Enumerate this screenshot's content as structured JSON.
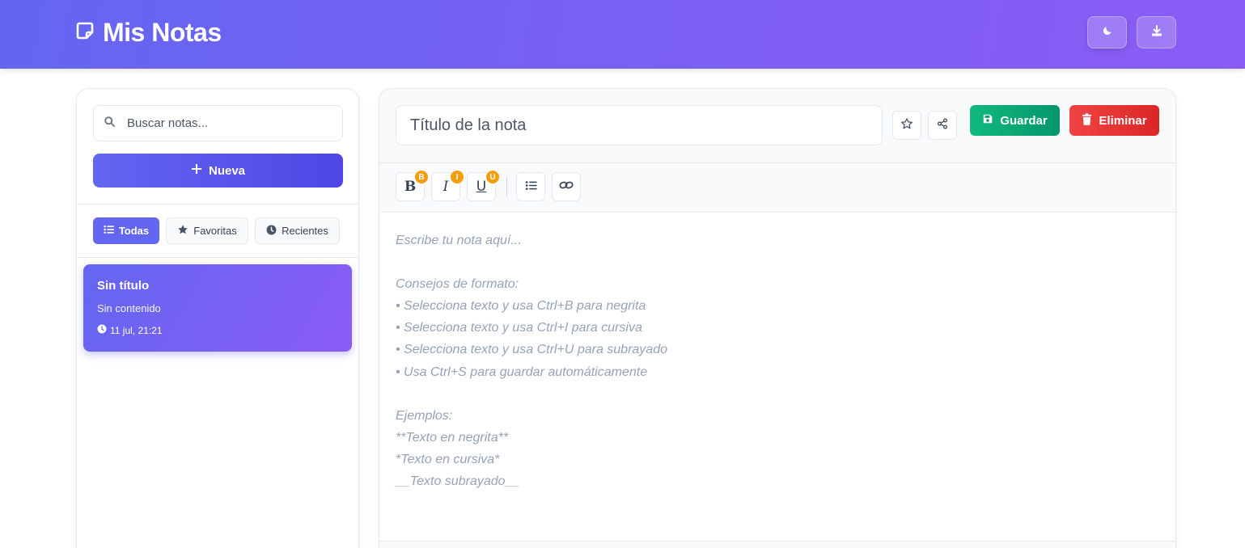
{
  "app": {
    "title": "Mis Notas",
    "logo_icon": "sticky-note-icon",
    "theme_toggle_icon": "moon-icon",
    "export_icon": "download-icon"
  },
  "colors": {
    "primary": "#6366f1",
    "secondary": "#8b5cf6",
    "save": "#10b981",
    "delete": "#ef4444",
    "badge": "#f59e0b"
  },
  "sidebar": {
    "search_placeholder": "Buscar notas...",
    "new_button_label": "Nueva",
    "filters": [
      {
        "label": "Todas",
        "icon": "list-icon",
        "active": true
      },
      {
        "label": "Favoritas",
        "icon": "star-icon",
        "active": false
      },
      {
        "label": "Recientes",
        "icon": "clock-icon",
        "active": false
      }
    ],
    "notes": [
      {
        "title": "Sin título",
        "preview": "Sin contenido",
        "date": "11 jul, 21:21"
      }
    ]
  },
  "editor": {
    "title_placeholder": "Título de la nota",
    "save_label": "Guardar",
    "delete_label": "Eliminar",
    "toolbar": {
      "bold": {
        "label": "B",
        "badge": "B"
      },
      "italic": {
        "label": "I",
        "badge": "I"
      },
      "underline": {
        "label": "U",
        "badge": "U"
      }
    },
    "content_placeholder": "Escribe tu nota aquí...\n\nConsejos de formato:\n• Selecciona texto y usa Ctrl+B para negrita\n• Selecciona texto y usa Ctrl+I para cursiva\n• Selecciona texto y usa Ctrl+U para subrayado\n• Usa Ctrl+S para guardar automáticamente\n\nEjemplos:\n**Texto en negrita**\n*Texto en cursiva*\n__Texto subrayado__"
  }
}
